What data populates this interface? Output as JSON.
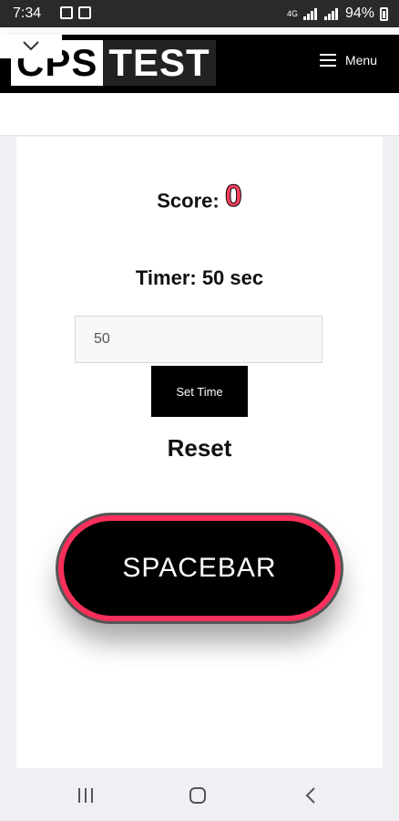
{
  "status_bar": {
    "time": "7:34",
    "network": "4G",
    "battery": "94%"
  },
  "header": {
    "logo_part1": "CPS",
    "logo_part2": "TEST",
    "menu_label": "Menu"
  },
  "game": {
    "score_label": "Score:",
    "score_value": "0",
    "timer_text": "Timer: 50 sec",
    "time_input_value": "50",
    "set_time_label": "Set Time",
    "reset_label": "Reset",
    "spacebar_label": "SPACEBAR"
  },
  "colors": {
    "accent": "#ff2f5c",
    "header_bg": "#000000"
  }
}
